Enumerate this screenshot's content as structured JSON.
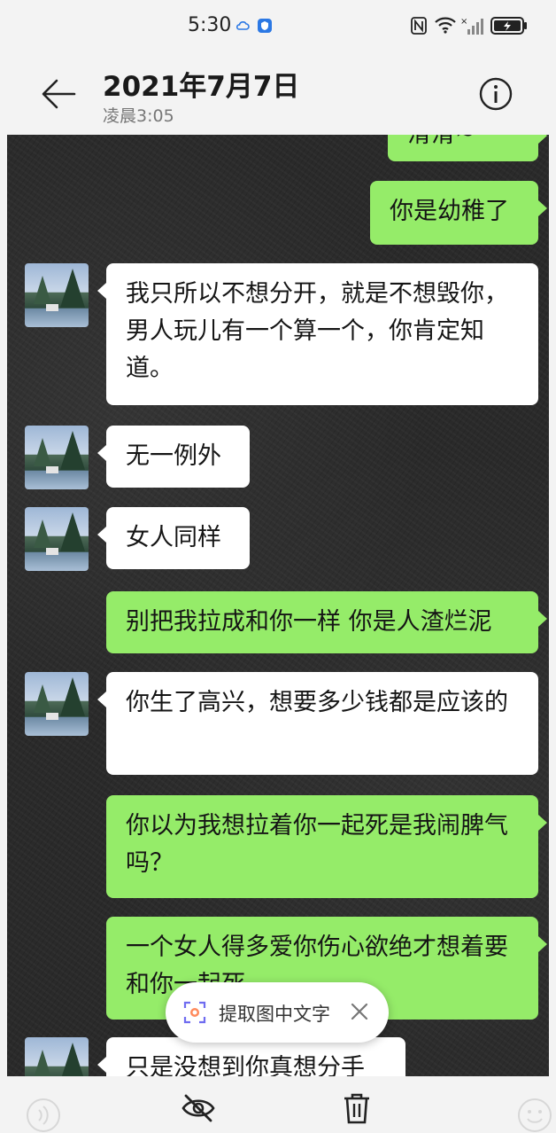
{
  "status_bar": {
    "time": "5:30",
    "icons": [
      "cloud-icon",
      "security-icon",
      "nfc-icon",
      "wifi-icon",
      "signal-icon",
      "battery-icon"
    ]
  },
  "header": {
    "title": "2021年7月7日",
    "subtitle": "凌晨3:05",
    "back_icon": "back-arrow-icon",
    "info_icon": "info-icon"
  },
  "messages": [
    {
      "side": "out",
      "text": "滑滑~"
    },
    {
      "side": "out",
      "text": "你是幼稚了"
    },
    {
      "side": "in",
      "text": "我只所以不想分开，就是不想毁你，男人玩儿有一个算一个，你肯定知道。"
    },
    {
      "side": "in",
      "text": "无一例外"
    },
    {
      "side": "in",
      "text": "女人同样"
    },
    {
      "side": "out",
      "text": "别把我拉成和你一样 你是人渣烂泥"
    },
    {
      "side": "in",
      "text": "你生了高兴，想要多少钱都是应该的"
    },
    {
      "side": "out",
      "text": "你以为我想拉着你一起死是我闹脾气吗？"
    },
    {
      "side": "out",
      "text": "一个女人得多爱你伤心欲绝才想着要和你一起死"
    },
    {
      "side": "in",
      "text": "只是没想到你真想分手"
    }
  ],
  "ocr_popup": {
    "label": "提取图中文字",
    "icon": "scan-text-icon"
  },
  "bottom_bar": {
    "icons": [
      "hide-eye-icon",
      "trash-icon"
    ]
  },
  "colors": {
    "incoming_bubble": "#ffffff",
    "outgoing_bubble": "#95ec69",
    "chat_background": "#2a2a2a"
  }
}
